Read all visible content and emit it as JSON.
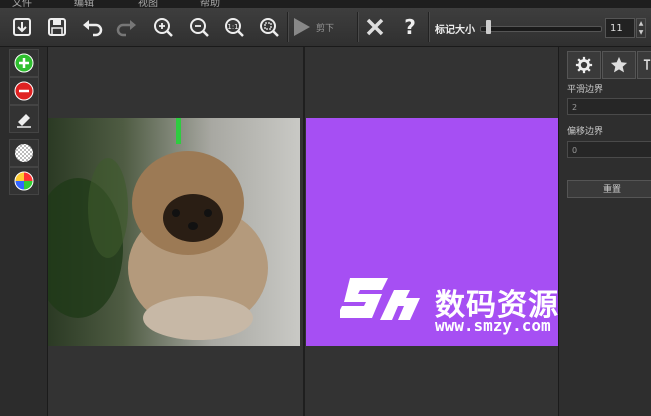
{
  "menu": {
    "items": [
      "文件",
      "编辑",
      "视图",
      "帮助"
    ]
  },
  "toolbar": {
    "cut_label": "剪下",
    "mark_size_label": "标记大小",
    "mark_size_value": "11",
    "mark_size_fraction": 0.05
  },
  "icons": {
    "open": "open-file-icon",
    "save": "save-icon",
    "undo": "undo-icon",
    "redo": "redo-icon",
    "zoom_in": "zoom-in-icon",
    "zoom_out": "zoom-out-icon",
    "actual_size": "actual-size-icon",
    "fit": "fit-window-icon",
    "play": "play-icon",
    "close": "close-icon",
    "help": "help-icon",
    "add_area": "add-area-icon",
    "remove_area": "remove-area-icon",
    "eraser": "eraser-icon",
    "transparency": "transparency-icon",
    "color": "color-wheel-icon",
    "settings": "gear-icon",
    "effects": "star-icon"
  },
  "right_panel": {
    "smooth_edge_label": "平滑边界",
    "smooth_edge_value": "2",
    "offset_edge_label": "偏移边界",
    "offset_edge_value": "0",
    "reset_label": "重置"
  },
  "watermark": {
    "text": "数码资源网",
    "url": "www.smzy.com"
  },
  "colors": {
    "mask": "#a64ff3",
    "background": "#2b2b2b"
  }
}
